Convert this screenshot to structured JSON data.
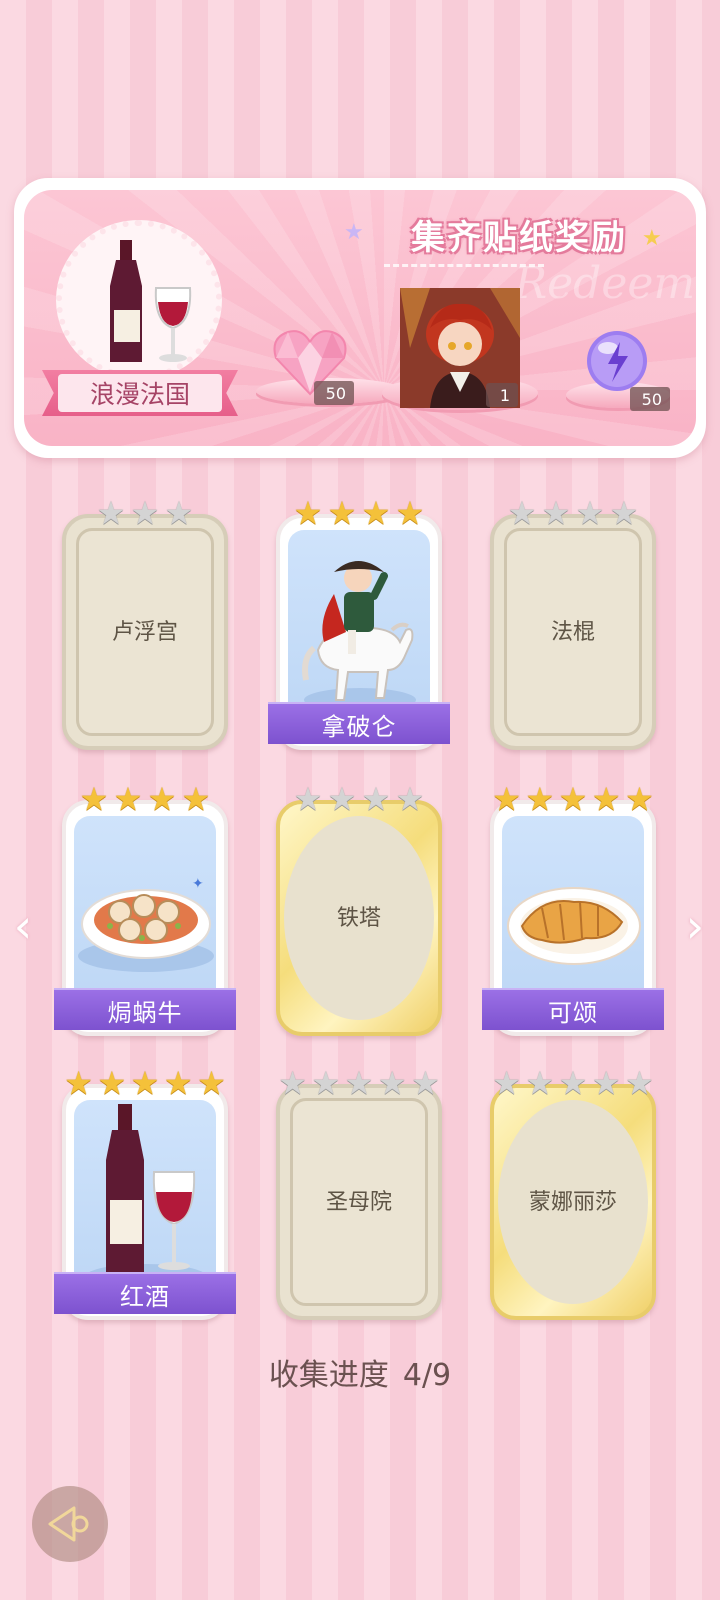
{
  "reward": {
    "title": "集齐贴纸奖励",
    "watermark": "Redeem",
    "theme_label": "浪漫法国",
    "items": [
      {
        "icon": "pink-heart-gem-icon",
        "count": "50"
      },
      {
        "icon": "character-portrait",
        "count": "1"
      },
      {
        "icon": "purple-energy-orb-icon",
        "count": "50"
      }
    ]
  },
  "cards": [
    {
      "name": "卢浮宫",
      "stars": 3,
      "star_color": "grey",
      "state": "locked-plain"
    },
    {
      "name": "拿破仑",
      "stars": 4,
      "star_color": "gold",
      "state": "unlocked",
      "art": "napoleon-on-horse"
    },
    {
      "name": "法棍",
      "stars": 4,
      "star_color": "grey",
      "state": "locked-plain"
    },
    {
      "name": "焗蜗牛",
      "stars": 4,
      "star_color": "gold",
      "state": "unlocked",
      "art": "escargot-dish"
    },
    {
      "name": "铁塔",
      "stars": 4,
      "star_color": "grey",
      "state": "locked-gold"
    },
    {
      "name": "可颂",
      "stars": 5,
      "star_color": "gold",
      "state": "unlocked",
      "art": "croissant-plate"
    },
    {
      "name": "红酒",
      "stars": 5,
      "star_color": "gold",
      "state": "unlocked",
      "art": "red-wine"
    },
    {
      "name": "圣母院",
      "stars": 5,
      "star_color": "grey",
      "state": "locked-plain"
    },
    {
      "name": "蒙娜丽莎",
      "stars": 5,
      "star_color": "grey",
      "state": "locked-gold"
    }
  ],
  "progress": {
    "label": "收集进度",
    "value": "4/9"
  },
  "colors": {
    "accent_pink": "#e65f8a",
    "banner_purple": "#8a5fdb",
    "star_gold": "#f4c13a"
  }
}
